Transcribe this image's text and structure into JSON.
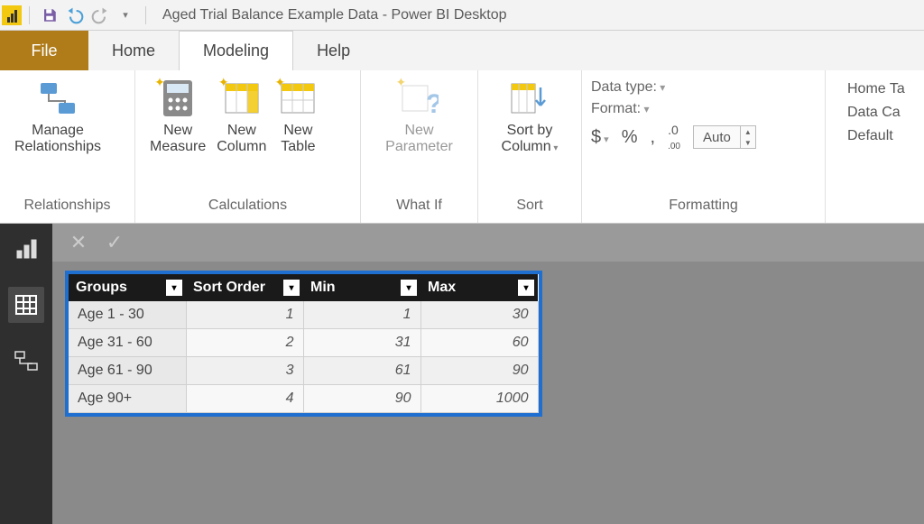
{
  "titlebar": {
    "title": "Aged Trial Balance Example Data - Power BI Desktop"
  },
  "tabs": {
    "file": "File",
    "home": "Home",
    "modeling": "Modeling",
    "help": "Help"
  },
  "ribbon": {
    "relationships": {
      "manage": "Manage\nRelationships",
      "group": "Relationships"
    },
    "calculations": {
      "measure": "New\nMeasure",
      "column": "New\nColumn",
      "table": "New\nTable",
      "group": "Calculations"
    },
    "whatif": {
      "param": "New\nParameter",
      "group": "What If"
    },
    "sort": {
      "btn": "Sort by\nColumn",
      "group": "Sort"
    },
    "formatting": {
      "datatype": "Data type:",
      "format": "Format:",
      "auto": "Auto",
      "group": "Formatting"
    },
    "properties": {
      "home_table": "Home Ta",
      "data_cat": "Data Ca",
      "default": "Default"
    }
  },
  "table": {
    "headers": [
      "Groups",
      "Sort Order",
      "Min",
      "Max"
    ],
    "rows": [
      {
        "g": "Age 1 - 30",
        "s": "1",
        "min": "1",
        "max": "30"
      },
      {
        "g": "Age 31 - 60",
        "s": "2",
        "min": "31",
        "max": "60"
      },
      {
        "g": "Age 61 - 90",
        "s": "3",
        "min": "61",
        "max": "90"
      },
      {
        "g": "Age 90+",
        "s": "4",
        "min": "90",
        "max": "1000"
      }
    ]
  }
}
